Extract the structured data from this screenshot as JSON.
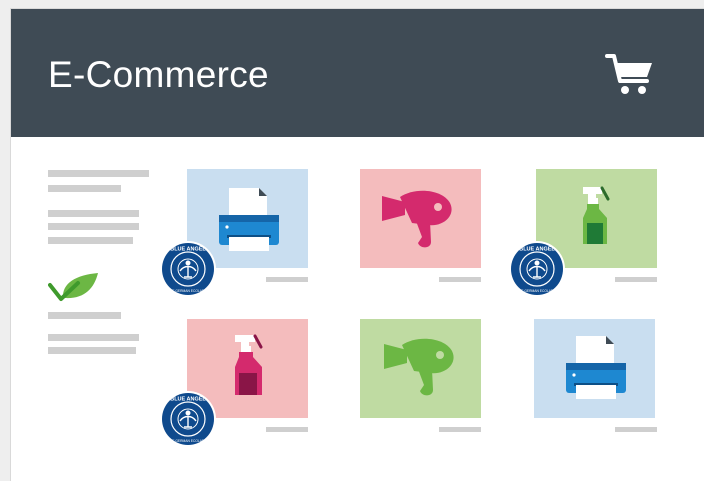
{
  "header": {
    "title": "E-Commerce",
    "cart_icon": "shopping-cart-icon"
  },
  "colors": {
    "header_bg": "#3f4b55",
    "tile_blue": "#c9def0",
    "tile_pink": "#f4bcbd",
    "tile_green": "#bfdba2",
    "magenta": "#d42a6d",
    "green": "#6cb744",
    "blue": "#1e88d1",
    "ecolabel": "#0f4a8d"
  },
  "sidebar": {
    "leaf_icon": "eco-leaf-icon"
  },
  "products": [
    {
      "icon": "printer-icon",
      "tile_color": "blue",
      "ecolabel": true
    },
    {
      "icon": "hair-dryer-icon",
      "tile_color": "pink",
      "ecolabel": false
    },
    {
      "icon": "spray-bottle-icon",
      "tile_color": "green",
      "ecolabel": true
    },
    {
      "icon": "spray-bottle-icon",
      "tile_color": "pink",
      "ecolabel": true
    },
    {
      "icon": "hair-dryer-icon",
      "tile_color": "green",
      "ecolabel": false
    },
    {
      "icon": "printer-icon",
      "tile_color": "blue",
      "ecolabel": false
    }
  ],
  "ecolabel": {
    "name": "BLUE ANGEL",
    "subtext": "THE GERMAN ECOLABEL",
    "icon": "blue-angel-ecolabel-icon"
  }
}
